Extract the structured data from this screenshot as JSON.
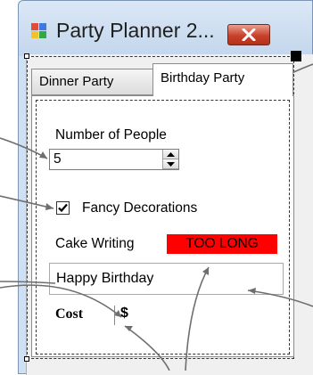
{
  "window": {
    "title": "Party Planner 2...",
    "close_symbol": "×"
  },
  "tabs": [
    {
      "label": "Dinner Party"
    },
    {
      "label": "Birthday Party"
    }
  ],
  "fields": {
    "number_of_people_label": "Number of People",
    "number_of_people_value": "5",
    "fancy_decorations_label": "Fancy Decorations",
    "fancy_decorations_checked": true,
    "cake_writing_label": "Cake Writing",
    "too_long_label": "TOO LONG",
    "cake_writing_value": "Happy Birthday",
    "cost_label": "Cost",
    "cost_value": "$"
  },
  "colors": {
    "too_long_bg": "#ff0000",
    "title_bar": "#cfe0f2",
    "close_button": "#c8412a"
  },
  "icons": {
    "app": "app-icon",
    "close": "close-icon",
    "spin_up": "triangle-up-icon",
    "spin_down": "triangle-down-icon",
    "check": "check-icon"
  }
}
